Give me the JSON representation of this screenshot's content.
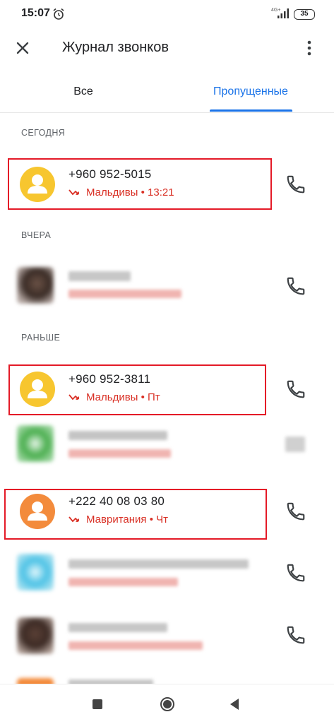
{
  "status_bar": {
    "time": "15:07",
    "network": "4G+",
    "battery": "35",
    "icons": [
      "alarm-icon",
      "signal-icon",
      "battery-icon"
    ]
  },
  "toolbar": {
    "title": "Журнал звонков",
    "close_icon": "close-icon",
    "more_icon": "more-vert-icon"
  },
  "tabs": [
    {
      "label": "Все",
      "selected": false
    },
    {
      "label": "Пропущенные",
      "selected": true
    }
  ],
  "sections": {
    "today": "СЕГОДНЯ",
    "yesterday": "ВЧЕРА",
    "earlier": "РАНЬШЕ"
  },
  "calls": [
    {
      "number": "+960 952-5015",
      "country": "Мальдивы",
      "time": "13:21",
      "detail": "Мальдивы • 13:21",
      "avatar_color": "#f7c62f",
      "highlighted": true
    },
    {
      "number": "+960 952-3811",
      "country": "Мальдивы",
      "time": "Пт",
      "detail": "Мальдивы • Пт",
      "avatar_color": "#f7c62f",
      "highlighted": true
    },
    {
      "number": "+222 40 08 03 80",
      "country": "Мавритания",
      "time": "Чт",
      "detail": "Мавритания • Чт",
      "avatar_color": "#f38b3c",
      "highlighted": true
    }
  ],
  "colors": {
    "accent": "#1a73e8",
    "missed": "#d93025",
    "highlight_box": "#e41a27"
  },
  "nav_bar": {
    "icons": [
      "recent-apps-icon",
      "home-icon",
      "back-icon"
    ]
  }
}
